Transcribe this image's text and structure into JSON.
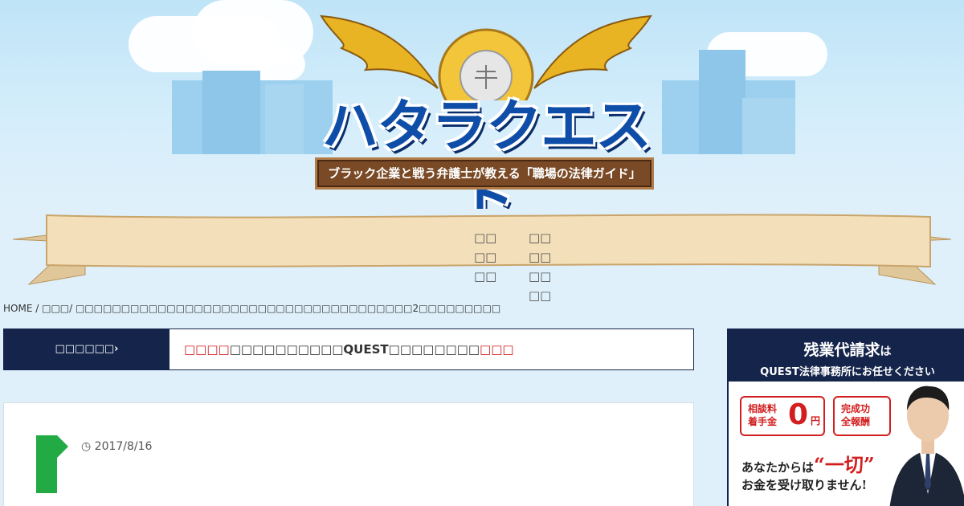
{
  "site": {
    "title": "ハタラクエスト",
    "subtitle": "ブラック企業と戦う弁護士が教える「職場の法律ガイド」"
  },
  "nav": {
    "col1": [
      "□□",
      "□□",
      "□□"
    ],
    "col2": [
      "□□",
      "□□",
      "□□",
      "□□"
    ]
  },
  "breadcrumb": {
    "home": "HOME",
    "sep": "/",
    "category": "□□□",
    "current": "□□□□□□□□□□□□□□□□□□□□□□□□□□□□□□□□□□□□□2□□□□□□□□□"
  },
  "news": {
    "label": "□□□□□□",
    "arrow": "›",
    "text_red_1": "□□□□",
    "text_main": "□□□□□□□□□□QUEST□□□□□□□□",
    "text_red_2": "□□□"
  },
  "article": {
    "date": "2017/8/16"
  },
  "ad": {
    "headline": "残業代請求",
    "headline_suffix": "は",
    "subline": "QUEST法律事務所にお任せください",
    "box1_line1": "相談料",
    "box1_line2": "着手金",
    "box1_zero": "0",
    "box1_unit": "円",
    "box2_line1": "完成功",
    "box2_line2": "全報酬",
    "line1_pre": "あなたからは",
    "line1_em": "“一切”",
    "line2": "お金を受け取りません!"
  },
  "colors": {
    "navy": "#14244a",
    "accent_red": "#d21e1e",
    "logo_blue": "#0f4ea8",
    "background": "#dff0fa"
  }
}
